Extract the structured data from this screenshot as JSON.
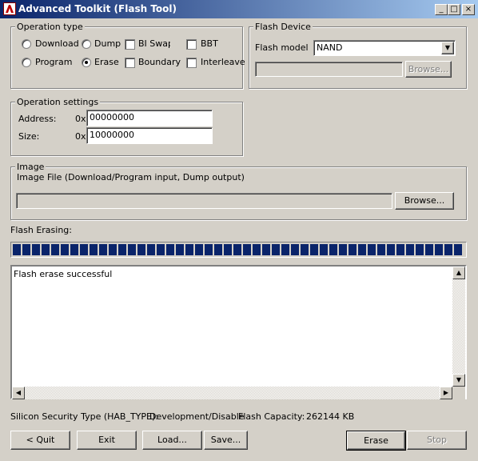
{
  "window": {
    "title": "Advanced Toolkit (Flash Tool)",
    "min_glyph": "_",
    "max_glyph": "□",
    "close_glyph": "×"
  },
  "operation_type": {
    "legend": "Operation type",
    "download": "Download",
    "dump": "Dump",
    "bi_swap": "BI Swap",
    "bbt": "BBT",
    "program": "Program",
    "erase": "Erase",
    "boundary": "Boundary",
    "interleave": "Interleave"
  },
  "flash_device": {
    "legend": "Flash Device",
    "model_label": "Flash model",
    "model_value": "NAND",
    "path_value": "",
    "browse": "Browse..."
  },
  "operation_settings": {
    "legend": "Operation settings",
    "address_label": "Address:",
    "size_label": "Size:",
    "hex_prefix": "0x",
    "address_value": "00000000",
    "size_value": "10000000"
  },
  "image": {
    "legend": "Image",
    "description": "Image File (Download/Program input, Dump output)",
    "path_value": "",
    "browse": "Browse..."
  },
  "progress": {
    "label": "Flash Erasing:",
    "fraction": 1.0
  },
  "log": {
    "text": "Flash erase successful"
  },
  "status": {
    "security_label": "Silicon Security Type (HAB_TYPE):",
    "security_value": "Development/Disable",
    "capacity_label": "Flash Capacity:",
    "capacity_value": "262144 KB"
  },
  "buttons": {
    "quit": "< Quit",
    "exit": "Exit",
    "load": "Load...",
    "save": "Save...",
    "erase": "Erase",
    "stop": "Stop"
  },
  "icons": {
    "scroll_up": "▲",
    "scroll_down": "▼",
    "scroll_left": "◀",
    "scroll_right": "▶",
    "dropdown": "▼"
  }
}
